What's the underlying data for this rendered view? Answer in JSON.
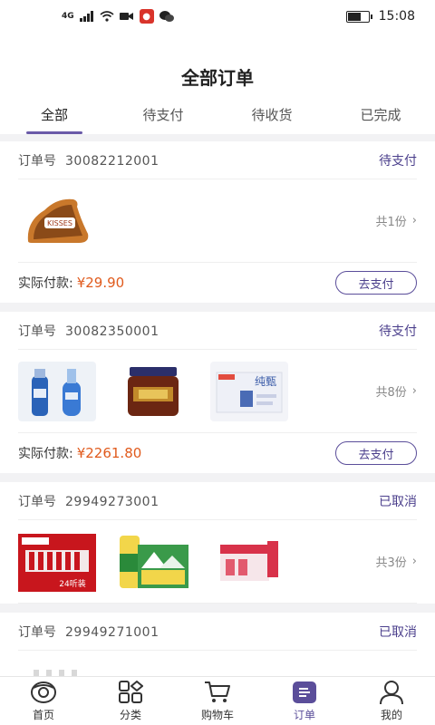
{
  "status_bar": {
    "network": "4G",
    "time": "15:08"
  },
  "header": {
    "title": "全部订单",
    "tabs": [
      {
        "label": "全部",
        "active": true
      },
      {
        "label": "待支付",
        "active": false
      },
      {
        "label": "待收货",
        "active": false
      },
      {
        "label": "已完成",
        "active": false
      }
    ]
  },
  "orders": [
    {
      "order_label": "订单号",
      "order_no": "30082212001",
      "status": "待支付",
      "count": "共1份",
      "thumbs": [
        "kisses-chocolate"
      ],
      "pay_label": "实际付款:",
      "price": "¥29.90",
      "pay_button": "去支付"
    },
    {
      "order_label": "订单号",
      "order_no": "30082350001",
      "status": "待支付",
      "count": "共8份",
      "thumbs": [
        "blue-liquor-bottles",
        "sauce-jar",
        "milk-box"
      ],
      "pay_label": "实际付款:",
      "price": "¥2261.80",
      "pay_button": "去支付"
    },
    {
      "order_label": "订单号",
      "order_no": "29949273001",
      "status": "已取消",
      "count": "共3份",
      "thumbs": [
        "budweiser-case",
        "beer-case",
        "drink-box"
      ]
    },
    {
      "order_label": "订单号",
      "order_no": "29949271001",
      "status": "已取消",
      "thumbs": [
        "cola-bottles"
      ]
    }
  ],
  "thumb_text": {
    "kisses": "KISSES",
    "milk": "纯甄",
    "beer_case": "24听装"
  },
  "tabbar": [
    {
      "label": "首页",
      "icon": "home-icon",
      "active": false
    },
    {
      "label": "分类",
      "icon": "category-icon",
      "active": false
    },
    {
      "label": "购物车",
      "icon": "cart-icon",
      "active": false
    },
    {
      "label": "订单",
      "icon": "orders-icon",
      "active": true
    },
    {
      "label": "我的",
      "icon": "profile-icon",
      "active": false
    }
  ],
  "colors": {
    "accent": "#5b4e9a",
    "price": "#e05a1c"
  }
}
